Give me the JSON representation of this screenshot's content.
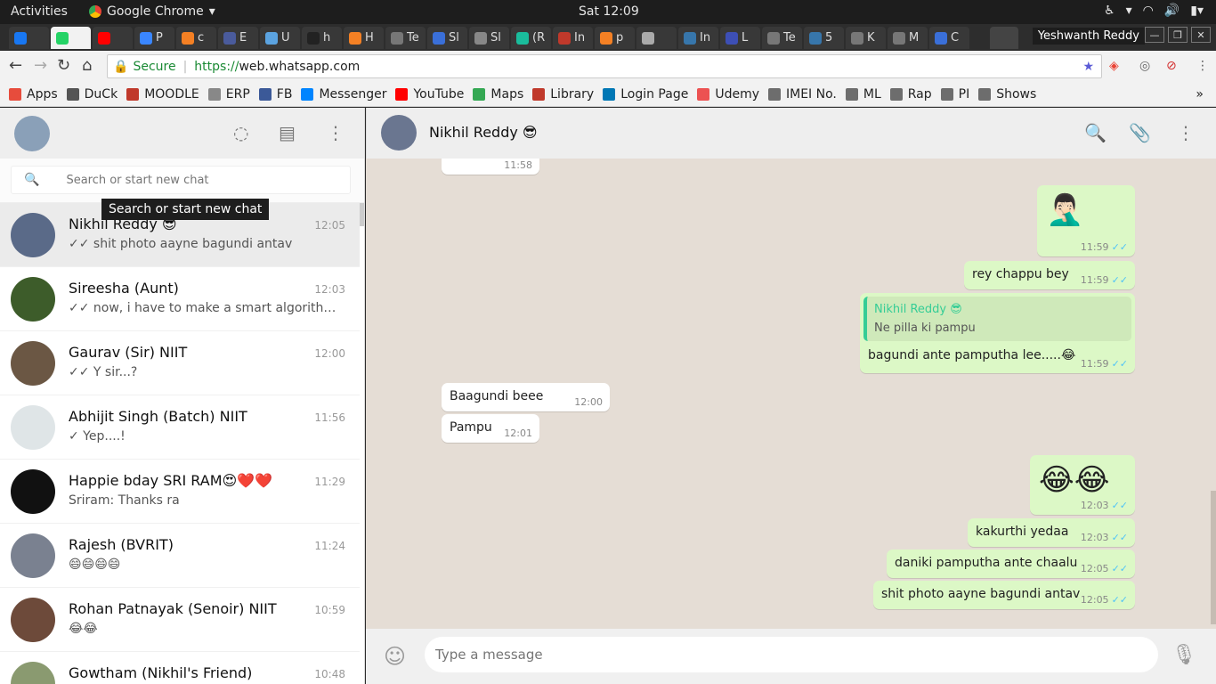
{
  "system": {
    "activities": "Activities",
    "app_name": "Google Chrome",
    "clock": "Sat 12:09",
    "profile": "Yeshwanth Reddy"
  },
  "tabs": [
    {
      "label": "",
      "color": "#1877f2"
    },
    {
      "label": "",
      "color": "#25d366"
    },
    {
      "label": "",
      "color": "#ff0000"
    },
    {
      "label": "P",
      "color": "#3a86ff"
    },
    {
      "label": "c",
      "color": "#f48024"
    },
    {
      "label": "E",
      "color": "#4a5b9c"
    },
    {
      "label": "U",
      "color": "#5ba3e0"
    },
    {
      "label": "h",
      "color": "#222222"
    },
    {
      "label": "H",
      "color": "#f48024"
    },
    {
      "label": "Te",
      "color": "#777777"
    },
    {
      "label": "Sl",
      "color": "#3a6fd8"
    },
    {
      "label": "Sl",
      "color": "#888888"
    },
    {
      "label": "(R",
      "color": "#1abc9c"
    },
    {
      "label": "In",
      "color": "#c0392b"
    },
    {
      "label": "p",
      "color": "#f48024"
    },
    {
      "label": "",
      "color": "#aaaaaa"
    },
    {
      "label": "In",
      "color": "#3776ab"
    },
    {
      "label": "L",
      "color": "#3d4fb5"
    },
    {
      "label": "Te",
      "color": "#777777"
    },
    {
      "label": "5",
      "color": "#3776ab"
    },
    {
      "label": "K",
      "color": "#777777"
    },
    {
      "label": "M",
      "color": "#777777"
    },
    {
      "label": "C",
      "color": "#3a6fd8"
    }
  ],
  "omnibox": {
    "secure": "Secure",
    "scheme": "https://",
    "host": "web.whatsapp.com"
  },
  "bookmarks": [
    {
      "label": "Apps",
      "color": "#e74c3c"
    },
    {
      "label": "DuCk",
      "color": "#555555"
    },
    {
      "label": "MOODLE",
      "color": "#c0392b"
    },
    {
      "label": "ERP",
      "color": "#888888"
    },
    {
      "label": "FB",
      "color": "#3b5998"
    },
    {
      "label": "Messenger",
      "color": "#0084ff"
    },
    {
      "label": "YouTube",
      "color": "#ff0000"
    },
    {
      "label": "Maps",
      "color": "#34a853"
    },
    {
      "label": "Library",
      "color": "#c0392b"
    },
    {
      "label": "Login Page",
      "color": "#0077b5"
    },
    {
      "label": "Udemy",
      "color": "#ec5252"
    },
    {
      "label": "IMEI No.",
      "color": "#6d6d6d"
    },
    {
      "label": "ML",
      "color": "#6d6d6d"
    },
    {
      "label": "Rap",
      "color": "#6d6d6d"
    },
    {
      "label": "PI",
      "color": "#6d6d6d"
    },
    {
      "label": "Shows",
      "color": "#6d6d6d"
    }
  ],
  "search": {
    "placeholder": "Search or start new chat",
    "tooltip": "Search or start new chat"
  },
  "chats": [
    {
      "name": "Nikhil Reddy 😎",
      "time": "12:05",
      "preview": "✓✓ shit photo aayne bagundi antav",
      "color": "#5a6a88"
    },
    {
      "name": "Sireesha (Aunt)",
      "time": "12:03",
      "preview": "✓✓ now, i have to make a smart algorithm which...",
      "color": "#3d5c2a"
    },
    {
      "name": "Gaurav (Sir) NIIT",
      "time": "12:00",
      "preview": "✓✓ Y sir...?",
      "color": "#6b5744"
    },
    {
      "name": "Abhijit Singh (Batch) NIIT",
      "time": "11:56",
      "preview": "✓ Yep....!",
      "color": "#dfe5e7"
    },
    {
      "name": "Happie bday SRI RAM😍❤️❤️",
      "time": "11:29",
      "preview": "Sriram: Thanks ra",
      "color": "#111111"
    },
    {
      "name": "Rajesh (BVRIT)",
      "time": "11:24",
      "preview": "😄😄😄😄",
      "color": "#7a8190"
    },
    {
      "name": "Rohan Patnayak (Senoir) NIIT",
      "time": "10:59",
      "preview": "😂😂",
      "color": "#6d4a3a"
    },
    {
      "name": "Gowtham (Nikhil's Friend)",
      "time": "10:48",
      "preview": "",
      "color": "#8a9a70"
    }
  ],
  "conversation": {
    "contact": "Nikhil Reddy 😎",
    "messages": [
      {
        "dir": "in",
        "text": "",
        "time": "11:58",
        "ticks": ""
      },
      {
        "dir": "out",
        "text": "🤦🏻‍♂️",
        "time": "11:59",
        "ticks": "✓✓"
      },
      {
        "dir": "out",
        "text": "rey chappu bey",
        "time": "11:59",
        "ticks": "✓✓"
      },
      {
        "dir": "out",
        "text": "bagundi ante pamputha lee.....😂",
        "time": "11:59",
        "ticks": "✓✓",
        "quote_name": "Nikhil Reddy 😎",
        "quote_text": "Ne pilla ki pampu"
      },
      {
        "dir": "in",
        "text": "Baagundi beee",
        "time": "12:00",
        "ticks": ""
      },
      {
        "dir": "in",
        "text": "Pampu",
        "time": "12:01",
        "ticks": ""
      },
      {
        "dir": "out",
        "text": "😂😂",
        "time": "12:03",
        "ticks": "✓✓"
      },
      {
        "dir": "out",
        "text": "kakurthi yedaa",
        "time": "12:03",
        "ticks": "✓✓"
      },
      {
        "dir": "out",
        "text": "daniki pamputha ante chaalu",
        "time": "12:05",
        "ticks": "✓✓"
      },
      {
        "dir": "out",
        "text": "shit photo aayne bagundi antav",
        "time": "12:05",
        "ticks": "✓✓"
      }
    ]
  },
  "composer": {
    "placeholder": "Type a message"
  },
  "icons": {
    "status": "status-icon",
    "new_chat": "new-chat-icon",
    "menu": "menu-dots-icon",
    "search": "search-icon",
    "attach": "paperclip-icon",
    "emoji": "emoji-icon",
    "mic": "microphone-icon"
  }
}
